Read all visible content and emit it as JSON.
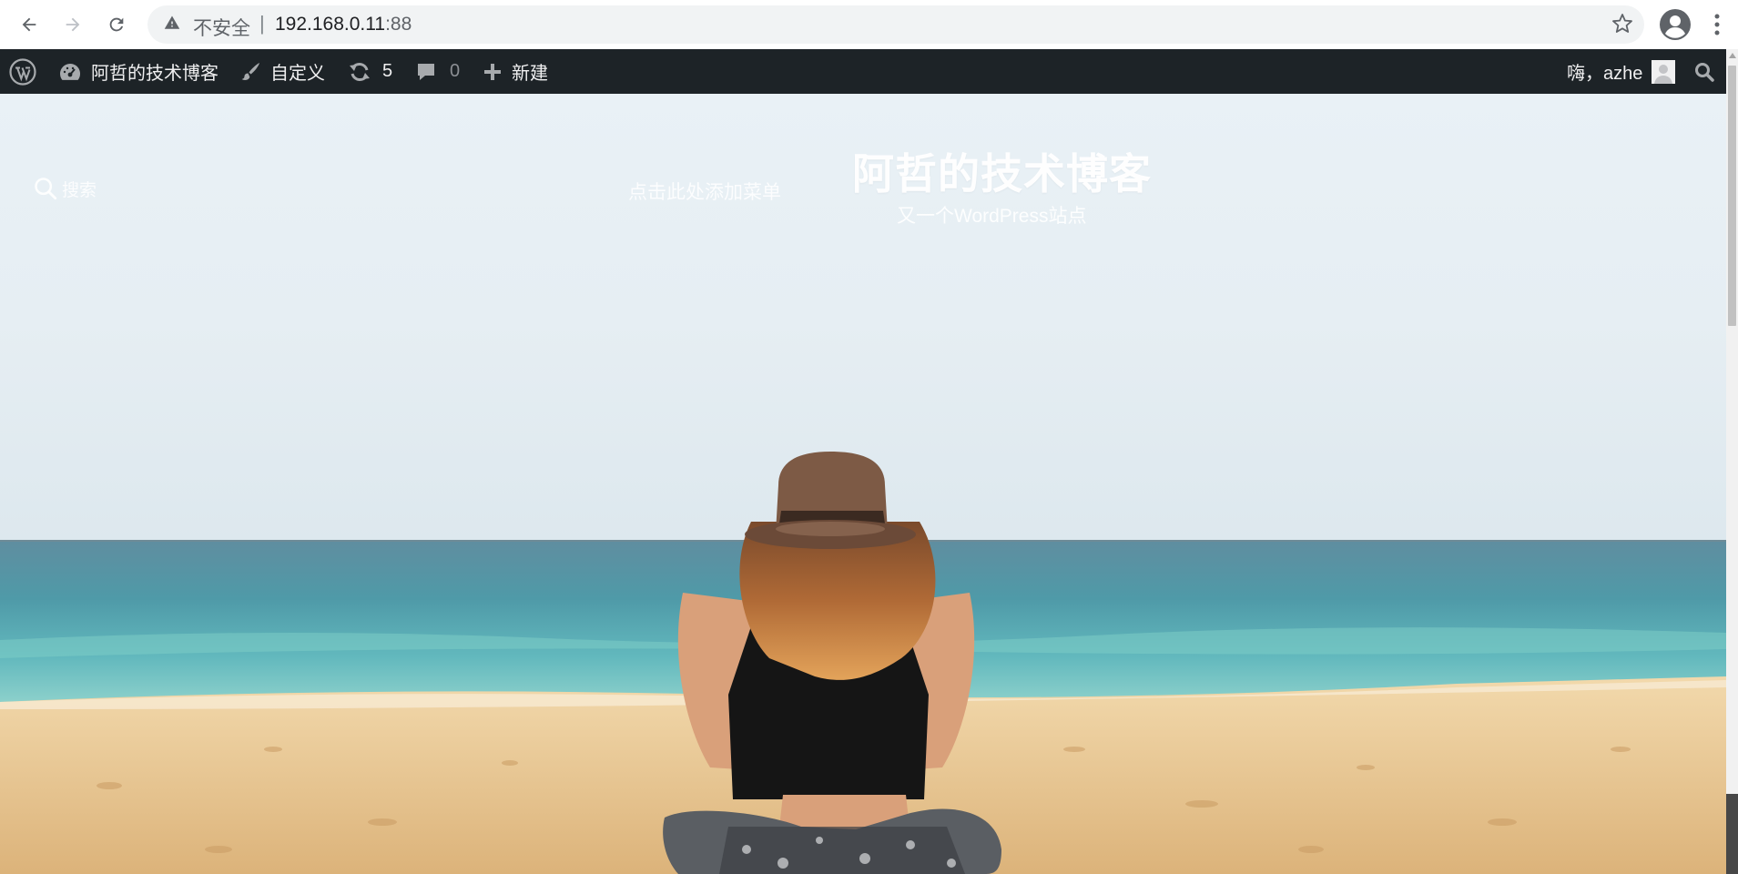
{
  "browser": {
    "security_label": "不安全",
    "separator": "|",
    "url_host": "192.168.0.11",
    "url_port": ":88",
    "icons": [
      "back-icon",
      "forward-icon",
      "reload-icon",
      "warning-icon",
      "star-icon",
      "profile-icon",
      "menu-dots-icon"
    ]
  },
  "adminbar": {
    "site_name": "阿哲的技术博客",
    "customize_label": "自定义",
    "updates_count": "5",
    "comments_count": "0",
    "new_label": "新建",
    "greeting": "嗨，azhe",
    "bg_color": "#1d2327",
    "icons": [
      "wordpress-logo-icon",
      "dashboard-icon",
      "brush-icon",
      "updates-icon",
      "comment-icon",
      "plus-icon",
      "avatar-icon",
      "search-icon"
    ]
  },
  "site": {
    "title": "阿哲的技术博客",
    "tagline": "又一个WordPress站点",
    "search_label": "搜索",
    "menu_hint": "点击此处添加菜单",
    "header_image": "beach-woman-hat-photo"
  }
}
